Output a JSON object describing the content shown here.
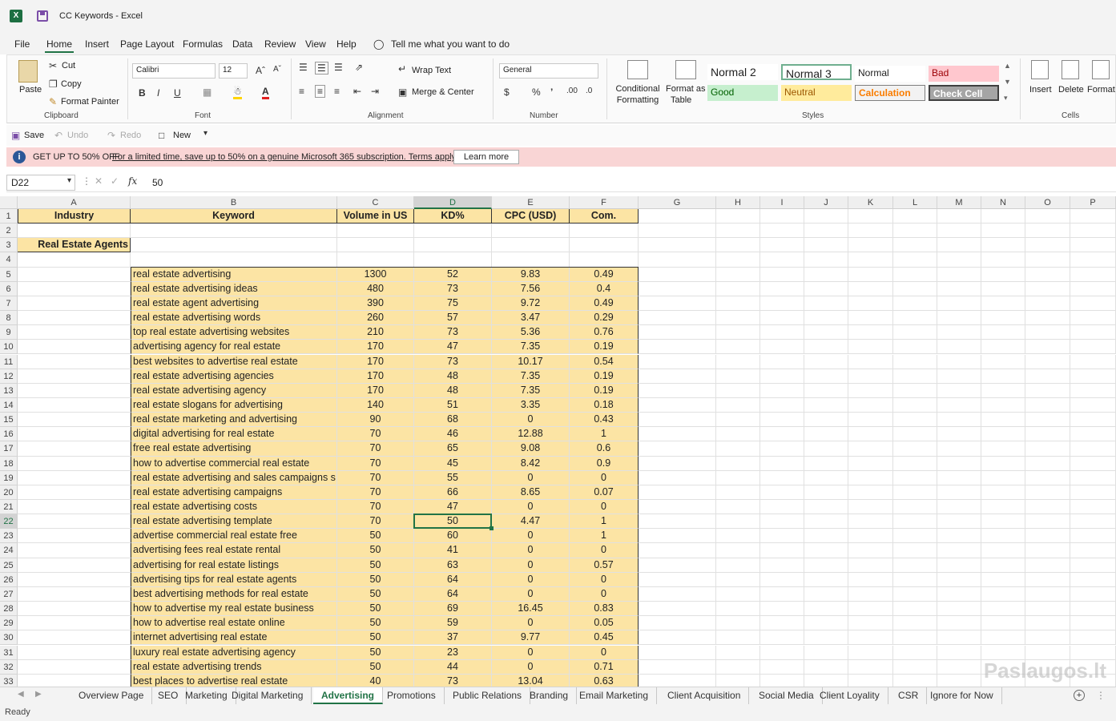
{
  "window": {
    "title": "CC Keywords  -  Excel"
  },
  "menu": [
    "File",
    "Home",
    "Insert",
    "Page Layout",
    "Formulas",
    "Data",
    "Review",
    "View",
    "Help"
  ],
  "tell_me": "Tell me what you want to do",
  "ribbon": {
    "clipboard": {
      "paste": "Paste",
      "cut": "Cut",
      "copy": "Copy",
      "format_painter": "Format Painter",
      "label": "Clipboard"
    },
    "font": {
      "name": "Calibri",
      "size": "12",
      "label": "Font"
    },
    "alignment": {
      "wrap": "Wrap Text",
      "merge": "Merge & Center",
      "label": "Alignment"
    },
    "number": {
      "format": "General",
      "label": "Number"
    },
    "styles": {
      "cond_fmt_1": "Conditional",
      "cond_fmt_2": "Formatting",
      "fmt_table_1": "Format as",
      "fmt_table_2": "Table",
      "cells": [
        "Normal 2",
        "Normal 3",
        "Normal",
        "Bad",
        "Good",
        "Neutral",
        "Calculation",
        "Check Cell"
      ],
      "label": "Styles"
    },
    "cells": {
      "insert": "Insert",
      "delete": "Delete",
      "format": "Format",
      "label": "Cells"
    }
  },
  "qat": {
    "save": "Save",
    "undo": "Undo",
    "redo": "Redo",
    "new": "New"
  },
  "banner": {
    "headline": "GET UP TO 50% OFF",
    "text": "For a limited time, save up to 50% on a genuine Microsoft 365 subscription. Terms apply.",
    "button": "Learn more"
  },
  "formula_bar": {
    "name_box": "D22",
    "value": "50"
  },
  "columns": [
    "A",
    "B",
    "C",
    "D",
    "E",
    "F",
    "G",
    "H",
    "I",
    "J",
    "K",
    "L",
    "M",
    "N",
    "O",
    "P"
  ],
  "headers": {
    "industry": "Industry",
    "keyword": "Keyword",
    "volume": "Volume in US",
    "kd": "KD%",
    "cpc": "CPC (USD)",
    "com": "Com."
  },
  "industry_label": "Real Estate Agents",
  "rows": [
    [
      "real estate advertising",
      "1300",
      "52",
      "9.83",
      "0.49"
    ],
    [
      "real estate advertising ideas",
      "480",
      "73",
      "7.56",
      "0.4"
    ],
    [
      "real estate agent advertising",
      "390",
      "75",
      "9.72",
      "0.49"
    ],
    [
      "real estate advertising words",
      "260",
      "57",
      "3.47",
      "0.29"
    ],
    [
      "top real estate advertising websites",
      "210",
      "73",
      "5.36",
      "0.76"
    ],
    [
      "advertising agency for real estate",
      "170",
      "47",
      "7.35",
      "0.19"
    ],
    [
      "best websites to advertise real estate",
      "170",
      "73",
      "10.17",
      "0.54"
    ],
    [
      "real estate advertising agencies",
      "170",
      "48",
      "7.35",
      "0.19"
    ],
    [
      "real estate advertising agency",
      "170",
      "48",
      "7.35",
      "0.19"
    ],
    [
      "real estate slogans for advertising",
      "140",
      "51",
      "3.35",
      "0.18"
    ],
    [
      "real estate marketing and advertising",
      "90",
      "68",
      "0",
      "0.43"
    ],
    [
      "digital advertising for real estate",
      "70",
      "46",
      "12.88",
      "1"
    ],
    [
      "free real estate advertising",
      "70",
      "65",
      "9.08",
      "0.6"
    ],
    [
      "how to advertise commercial real estate",
      "70",
      "45",
      "8.42",
      "0.9"
    ],
    [
      "real estate advertising and sales campaigns s",
      "70",
      "55",
      "0",
      "0"
    ],
    [
      "real estate advertising campaigns",
      "70",
      "66",
      "8.65",
      "0.07"
    ],
    [
      "real estate advertising costs",
      "70",
      "47",
      "0",
      "0"
    ],
    [
      "real estate advertising template",
      "70",
      "50",
      "4.47",
      "1"
    ],
    [
      "advertise commercial real estate free",
      "50",
      "60",
      "0",
      "1"
    ],
    [
      "advertising fees real estate rental",
      "50",
      "41",
      "0",
      "0"
    ],
    [
      "advertising for real estate listings",
      "50",
      "63",
      "0",
      "0.57"
    ],
    [
      "advertising tips for real estate agents",
      "50",
      "64",
      "0",
      "0"
    ],
    [
      "best advertising methods for real estate",
      "50",
      "64",
      "0",
      "0"
    ],
    [
      "how to advertise my real estate business",
      "50",
      "69",
      "16.45",
      "0.83"
    ],
    [
      "how to advertise real estate online",
      "50",
      "59",
      "0",
      "0.05"
    ],
    [
      "internet advertising real estate",
      "50",
      "37",
      "9.77",
      "0.45"
    ],
    [
      "luxury real estate advertising agency",
      "50",
      "23",
      "0",
      "0"
    ],
    [
      "real estate advertising trends",
      "50",
      "44",
      "0",
      "0.71"
    ],
    [
      "best places to advertise real estate",
      "40",
      "73",
      "13.04",
      "0.63"
    ]
  ],
  "sheets": [
    "Overview Page",
    "SEO",
    "Marketing",
    "Digital Marketing",
    "Advertising",
    "Promotions",
    "Public Relations",
    "Branding",
    "Email Marketing",
    "Client Acquisition",
    "Social Media",
    "Client Loyality",
    "CSR",
    "Ignore for Now"
  ],
  "active_sheet": "Advertising",
  "status": "Ready",
  "watermark": "Paslaugos.lt"
}
